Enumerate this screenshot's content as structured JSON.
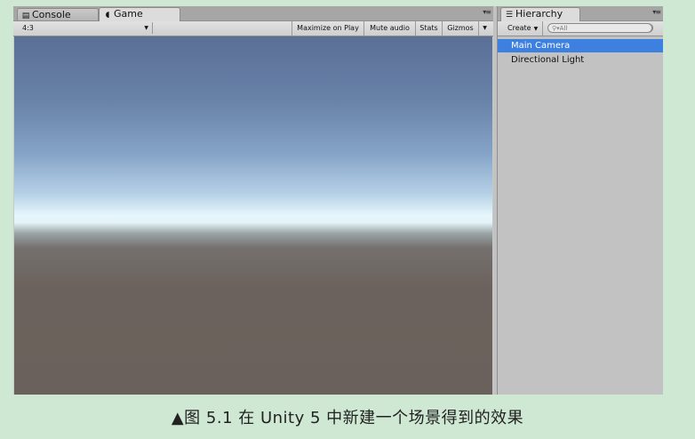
{
  "game_panel": {
    "tabs": [
      {
        "label": "Console",
        "icon": "console-icon"
      },
      {
        "label": "Game",
        "icon": "pacman-game-icon"
      }
    ],
    "aspect_ratio": "4:3",
    "buttons": {
      "maximize": "Maximize on Play",
      "mute": "Mute audio",
      "stats": "Stats",
      "gizmos": "Gizmos"
    }
  },
  "hierarchy": {
    "tab_label": "Hierarchy",
    "icon": "list-icon",
    "create_label": "Create",
    "search_placeholder": "All",
    "items": [
      {
        "label": "Main Camera",
        "selected": true
      },
      {
        "label": "Directional Light",
        "selected": false
      }
    ]
  },
  "colors": {
    "selection": "#3d80df",
    "page_background": "#cfe8d3"
  },
  "caption": "▲图 5.1   在 Unity 5 中新建一个场景得到的效果"
}
